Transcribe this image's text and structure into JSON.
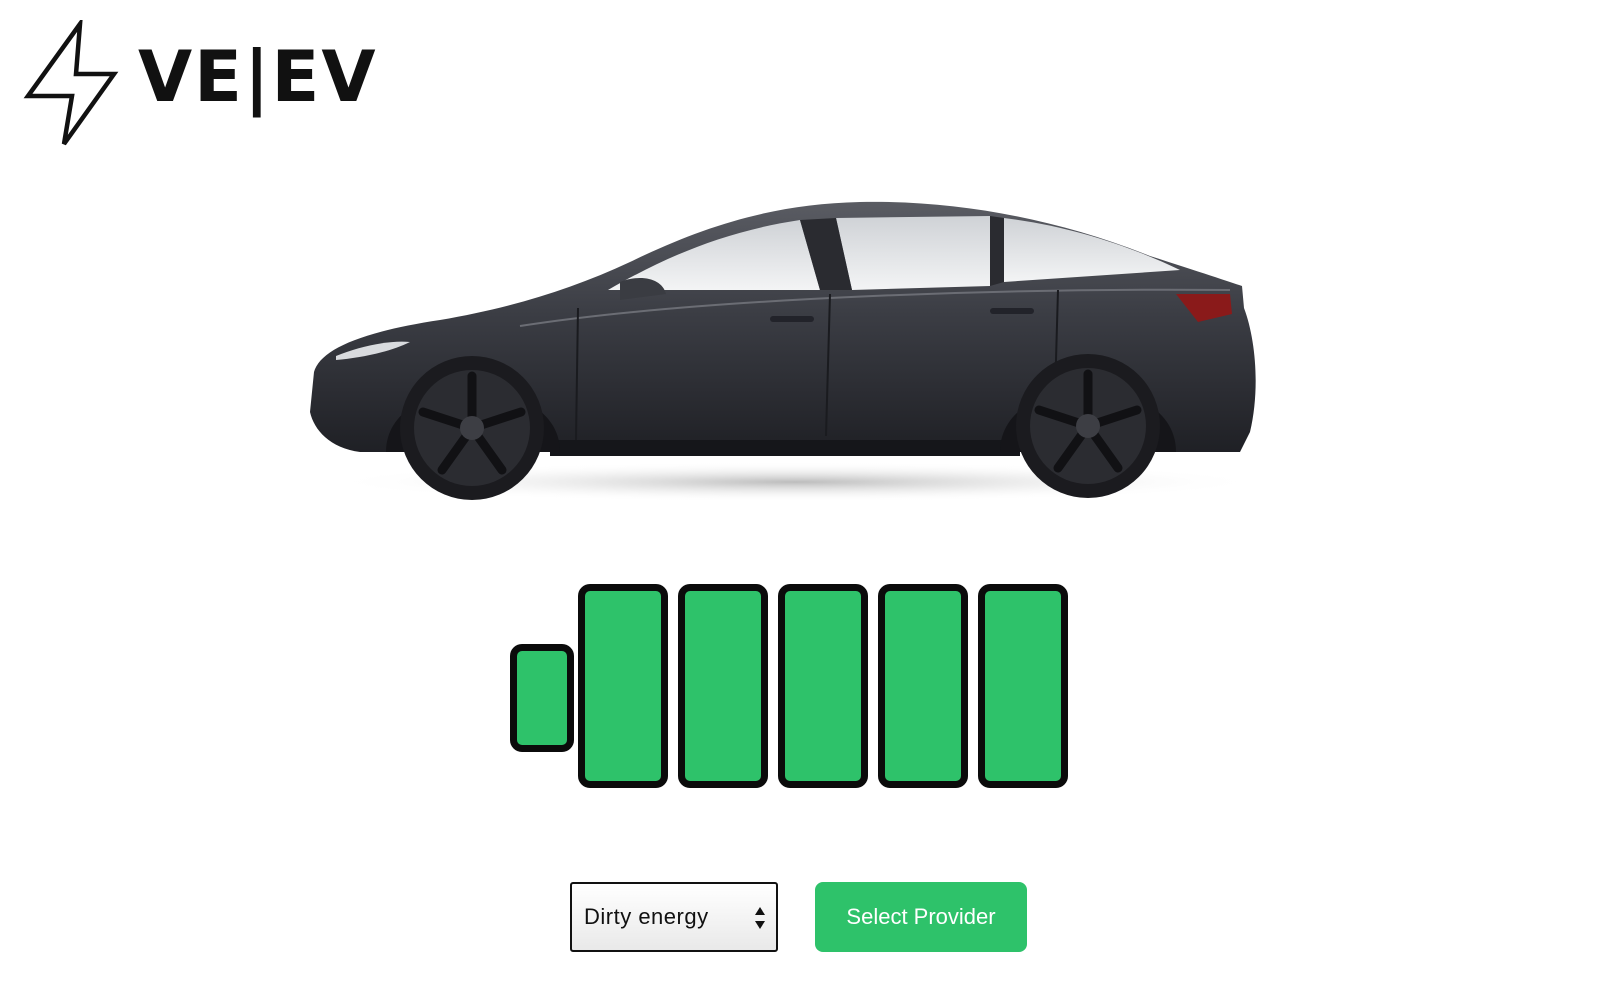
{
  "brand": {
    "logo_text": "VE|EV",
    "logo_icon": "lightning-bolt-icon"
  },
  "car": {
    "image": "car-side-view"
  },
  "battery": {
    "cells_total": 5,
    "cells_filled": 5,
    "fill_color": "#2ec26a",
    "outline_color": "#0b0b0b"
  },
  "controls": {
    "energy_select": {
      "selected": "Dirty energy",
      "icon": "select-arrows-icon"
    },
    "provider_button_label": "Select Provider",
    "accent_color": "#2ec26a"
  }
}
